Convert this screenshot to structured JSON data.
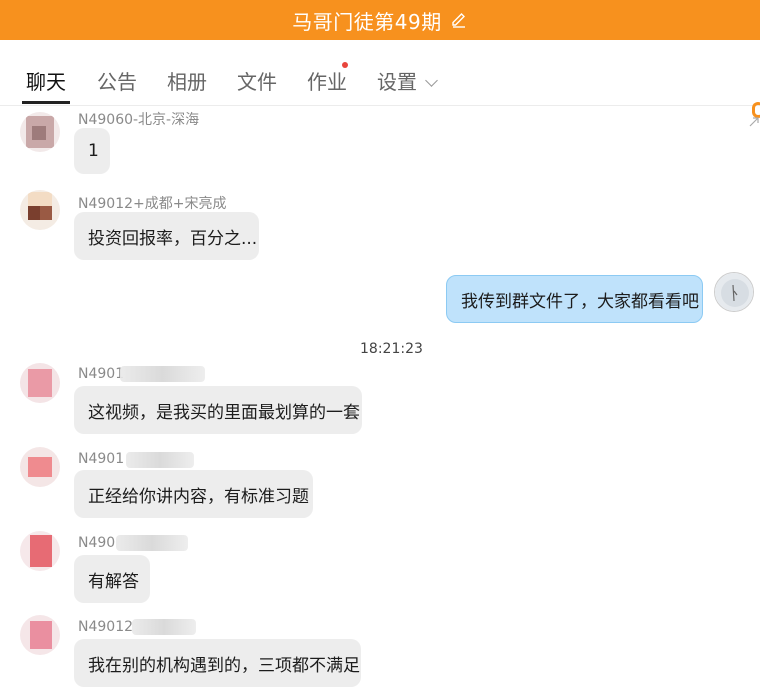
{
  "header": {
    "title": "马哥门徒第49期",
    "icon": "edit-icon"
  },
  "tabs": [
    {
      "label": "聊天",
      "active": true
    },
    {
      "label": "公告"
    },
    {
      "label": "相册"
    },
    {
      "label": "文件"
    },
    {
      "label": "作业",
      "badge_dot": true
    },
    {
      "label": "设置",
      "has_dropdown": true
    }
  ],
  "messages": [
    {
      "sender": "N49060-北京-深海",
      "text": "1"
    },
    {
      "sender": "N49012+成都+宋亮成",
      "text": "投资回报率，百分之..."
    },
    {
      "self": true,
      "text": "我传到群文件了，大家都看看吧"
    },
    {
      "sender": "N4901",
      "text": "这视频，是我买的里面最划算的一套"
    },
    {
      "sender": "N4901",
      "text": "正经给你讲内容，有标准习题"
    },
    {
      "sender": "N490",
      "text": "有解答"
    },
    {
      "sender": "N49012",
      "text": "我在别的机构遇到的，三项都不满足"
    }
  ],
  "timestamp": "18:21:23",
  "colors": {
    "accent": "#f7911e",
    "self_bubble": "#bfe2fb",
    "other_bubble": "#ededed",
    "badge": "#e8453c"
  }
}
